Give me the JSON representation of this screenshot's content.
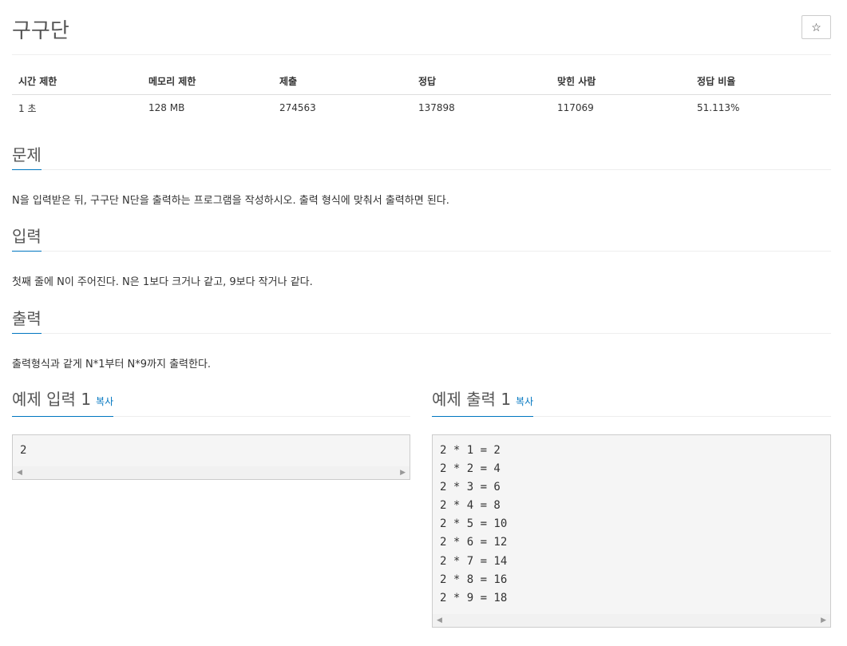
{
  "problem": {
    "title": "구구단",
    "favorite_icon": "☆"
  },
  "info_table": {
    "headers": [
      "시간 제한",
      "메모리 제한",
      "제출",
      "정답",
      "맞힌 사람",
      "정답 비율"
    ],
    "values": [
      "1 초",
      "128 MB",
      "274563",
      "137898",
      "117069",
      "51.113%"
    ]
  },
  "sections": {
    "problem": {
      "title": "문제",
      "body": "N을 입력받은 뒤, 구구단 N단을 출력하는 프로그램을 작성하시오. 출력 형식에 맞춰서 출력하면 된다."
    },
    "input": {
      "title": "입력",
      "body": "첫째 줄에 N이 주어진다. N은 1보다 크거나 같고, 9보다 작거나 같다."
    },
    "output": {
      "title": "출력",
      "body": "출력형식과 같게 N*1부터 N*9까지 출력한다."
    }
  },
  "samples": {
    "input": {
      "title": "예제 입력 1",
      "copy_label": "복사",
      "content": "2"
    },
    "output": {
      "title": "예제 출력 1",
      "copy_label": "복사",
      "content": "2 * 1 = 2\n2 * 2 = 4\n2 * 3 = 6\n2 * 4 = 8\n2 * 5 = 10\n2 * 6 = 12\n2 * 7 = 14\n2 * 8 = 16\n2 * 9 = 18"
    }
  },
  "scroll_arrows": {
    "left": "◀",
    "right": "▶"
  },
  "colors": {
    "accent": "#0076c0",
    "sample_bg": "#f5f5f5"
  }
}
